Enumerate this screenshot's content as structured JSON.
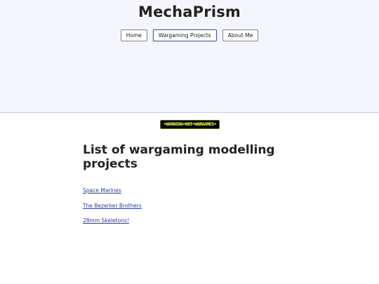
{
  "site": {
    "title": "MechaPrism"
  },
  "nav": {
    "items": [
      {
        "label": "Home"
      },
      {
        "label": "Wargaming Projects",
        "active": true
      },
      {
        "label": "About Me"
      }
    ]
  },
  "badge": {
    "text": "•WARNING•HOT•WARGAMES•",
    "colors": {
      "background": "#000000",
      "text": "#d9d24a"
    }
  },
  "main": {
    "heading": "List of wargaming modelling projects",
    "projects": [
      {
        "label": "Space Marines"
      },
      {
        "label": "The Bezerker Brothers"
      },
      {
        "label": "28mm Skeletons!"
      }
    ]
  },
  "colors": {
    "header_bg": "#f5f6fd",
    "link": "#2b3f9e"
  }
}
